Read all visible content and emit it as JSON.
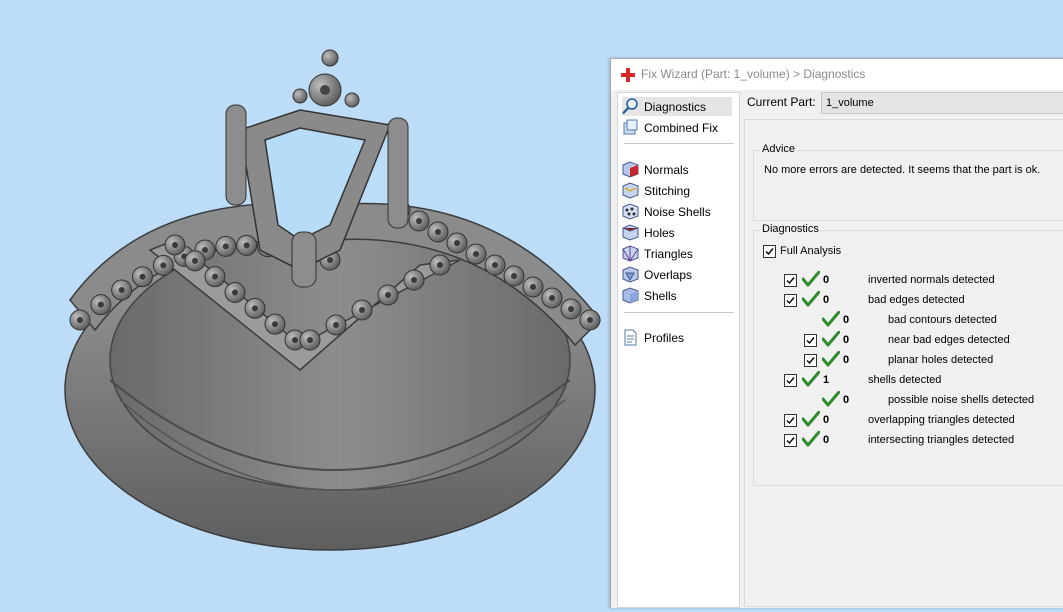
{
  "window": {
    "title": "Fix Wizard (Part: 1_volume) > Diagnostics"
  },
  "nav": {
    "group1": [
      {
        "label": "Diagnostics",
        "icon": "magnifier-icon",
        "selected": true
      },
      {
        "label": "Combined Fix",
        "icon": "combined-fix-icon"
      }
    ],
    "group2": [
      {
        "label": "Normals",
        "icon": "normals-cube-icon"
      },
      {
        "label": "Stitching",
        "icon": "stitching-cube-icon"
      },
      {
        "label": "Noise Shells",
        "icon": "noise-shells-icon"
      },
      {
        "label": "Holes",
        "icon": "holes-cube-icon"
      },
      {
        "label": "Triangles",
        "icon": "triangles-cube-icon"
      },
      {
        "label": "Overlaps",
        "icon": "overlaps-cube-icon"
      },
      {
        "label": "Shells",
        "icon": "shells-cube-icon"
      }
    ],
    "group3": [
      {
        "label": "Profiles",
        "icon": "document-icon"
      }
    ]
  },
  "current_part": {
    "label": "Current Part:",
    "value": "1_volume"
  },
  "advice": {
    "legend": "Advice",
    "message": "No more errors are detected. It seems that the part is ok."
  },
  "diagnostics": {
    "legend": "Diagnostics",
    "full_analysis_label": "Full Analysis",
    "full_analysis_checked": true,
    "rows": [
      {
        "count": "0",
        "label": "inverted normals detected",
        "checkbox": true,
        "level": 0
      },
      {
        "count": "0",
        "label": "bad edges detected",
        "checkbox": true,
        "level": 0
      },
      {
        "count": "0",
        "label": "bad contours detected",
        "checkbox": false,
        "level": 1
      },
      {
        "count": "0",
        "label": "near bad edges detected",
        "checkbox": true,
        "level": 1
      },
      {
        "count": "0",
        "label": "planar holes detected",
        "checkbox": true,
        "level": 1
      },
      {
        "count": "1",
        "label": "shells detected",
        "checkbox": true,
        "level": 0
      },
      {
        "count": "0",
        "label": "possible noise shells detected",
        "checkbox": false,
        "level": 1
      },
      {
        "count": "0",
        "label": "overlapping triangles detected",
        "checkbox": true,
        "level": 0
      },
      {
        "count": "0",
        "label": "intersecting triangles detected",
        "checkbox": true,
        "level": 0
      }
    ]
  },
  "colors": {
    "viewport_bg": "#bcdcf7",
    "model_gray": "#8a8a8a",
    "check_green": "#2e8b2e",
    "close_red": "#d9262b"
  }
}
